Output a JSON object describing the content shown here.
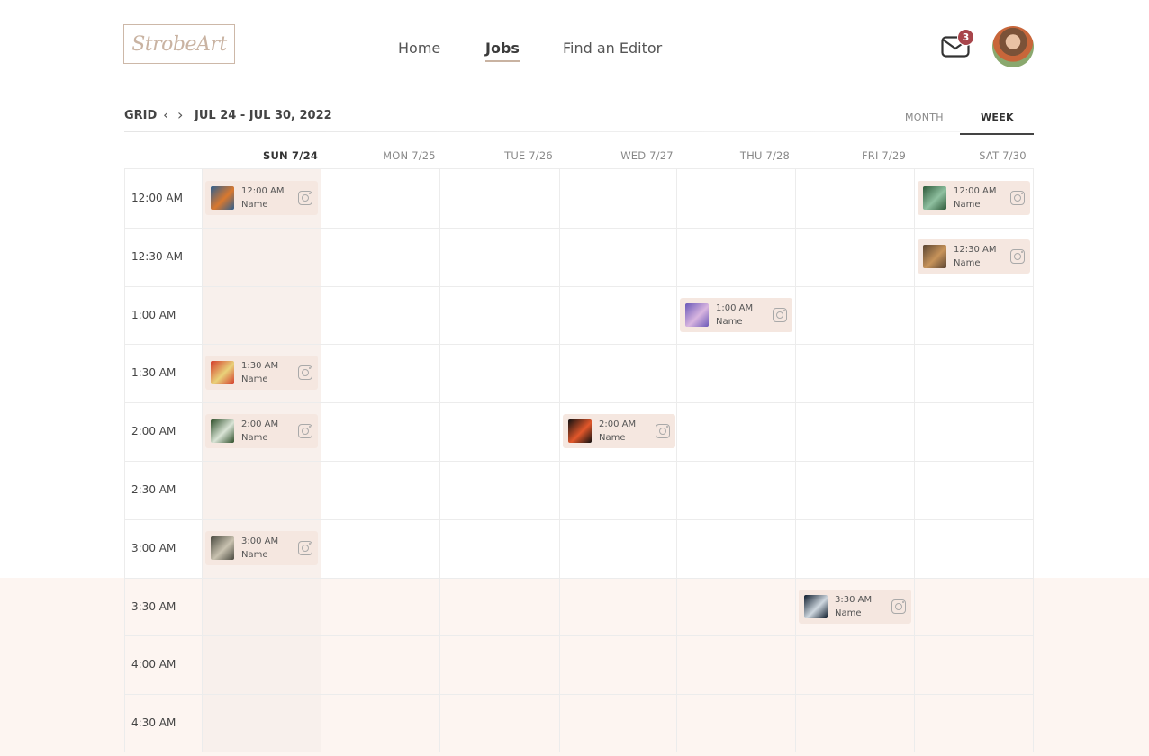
{
  "header": {
    "logo_text": "StrobeArt",
    "nav": [
      {
        "label": "Home"
      },
      {
        "label": "Jobs"
      },
      {
        "label": "Find an Editor"
      }
    ],
    "mail_badge": "3"
  },
  "toolbar": {
    "grid_label": "GRID",
    "prev_icon": "‹",
    "next_icon": "›",
    "date_range": "JUL 24 - JUL 30, 2022",
    "tab_month": "MONTH",
    "tab_week": "WEEK"
  },
  "days": [
    {
      "label": "SUN 7/24"
    },
    {
      "label": "MON 7/25"
    },
    {
      "label": "TUE 7/26"
    },
    {
      "label": "WED 7/27"
    },
    {
      "label": "THU 7/28"
    },
    {
      "label": "FRI 7/29"
    },
    {
      "label": "SAT 7/30"
    }
  ],
  "time_slots": [
    "12:00 AM",
    "12:30 AM",
    "1:00 AM",
    "1:30 AM",
    "2:00 AM",
    "2:30 AM",
    "3:00 AM",
    "3:30 AM",
    "4:00 AM",
    "4:30 AM"
  ],
  "events": [
    {
      "day": 0,
      "slot": 0,
      "time": "12:00 AM",
      "name": "Name",
      "thumb_colors": [
        "#2f5f8f",
        "#d9782e"
      ]
    },
    {
      "day": 6,
      "slot": 0,
      "time": "12:00 AM",
      "name": "Name",
      "thumb_colors": [
        "#2e5a3a",
        "#8fc0a0"
      ]
    },
    {
      "day": 6,
      "slot": 1,
      "time": "12:30 AM",
      "name": "Name",
      "thumb_colors": [
        "#5a4432",
        "#c7935a"
      ]
    },
    {
      "day": 4,
      "slot": 2,
      "time": "1:00 AM",
      "name": "Name",
      "thumb_colors": [
        "#6a58b8",
        "#d9b6e0"
      ]
    },
    {
      "day": 0,
      "slot": 3,
      "time": "1:30 AM",
      "name": "Name",
      "thumb_colors": [
        "#d33c2b",
        "#e9d27a"
      ]
    },
    {
      "day": 0,
      "slot": 4,
      "time": "2:00 AM",
      "name": "Name",
      "thumb_colors": [
        "#2f4f2a",
        "#d9e4d6"
      ]
    },
    {
      "day": 3,
      "slot": 4,
      "time": "2:00 AM",
      "name": "Name",
      "thumb_colors": [
        "#111111",
        "#e2572a"
      ]
    },
    {
      "day": 0,
      "slot": 6,
      "time": "3:00 AM",
      "name": "Name",
      "thumb_colors": [
        "#4a4a40",
        "#c9c2b0"
      ]
    },
    {
      "day": 5,
      "slot": 7,
      "time": "3:30 AM",
      "name": "Name",
      "thumb_colors": [
        "#0c1a2a",
        "#cfd8e0"
      ]
    }
  ],
  "colors": {
    "accent": "#c9b3a2",
    "badge": "#a8454b",
    "event_bg": "#f5e7e0",
    "today_bg": "#f8f0ec"
  }
}
